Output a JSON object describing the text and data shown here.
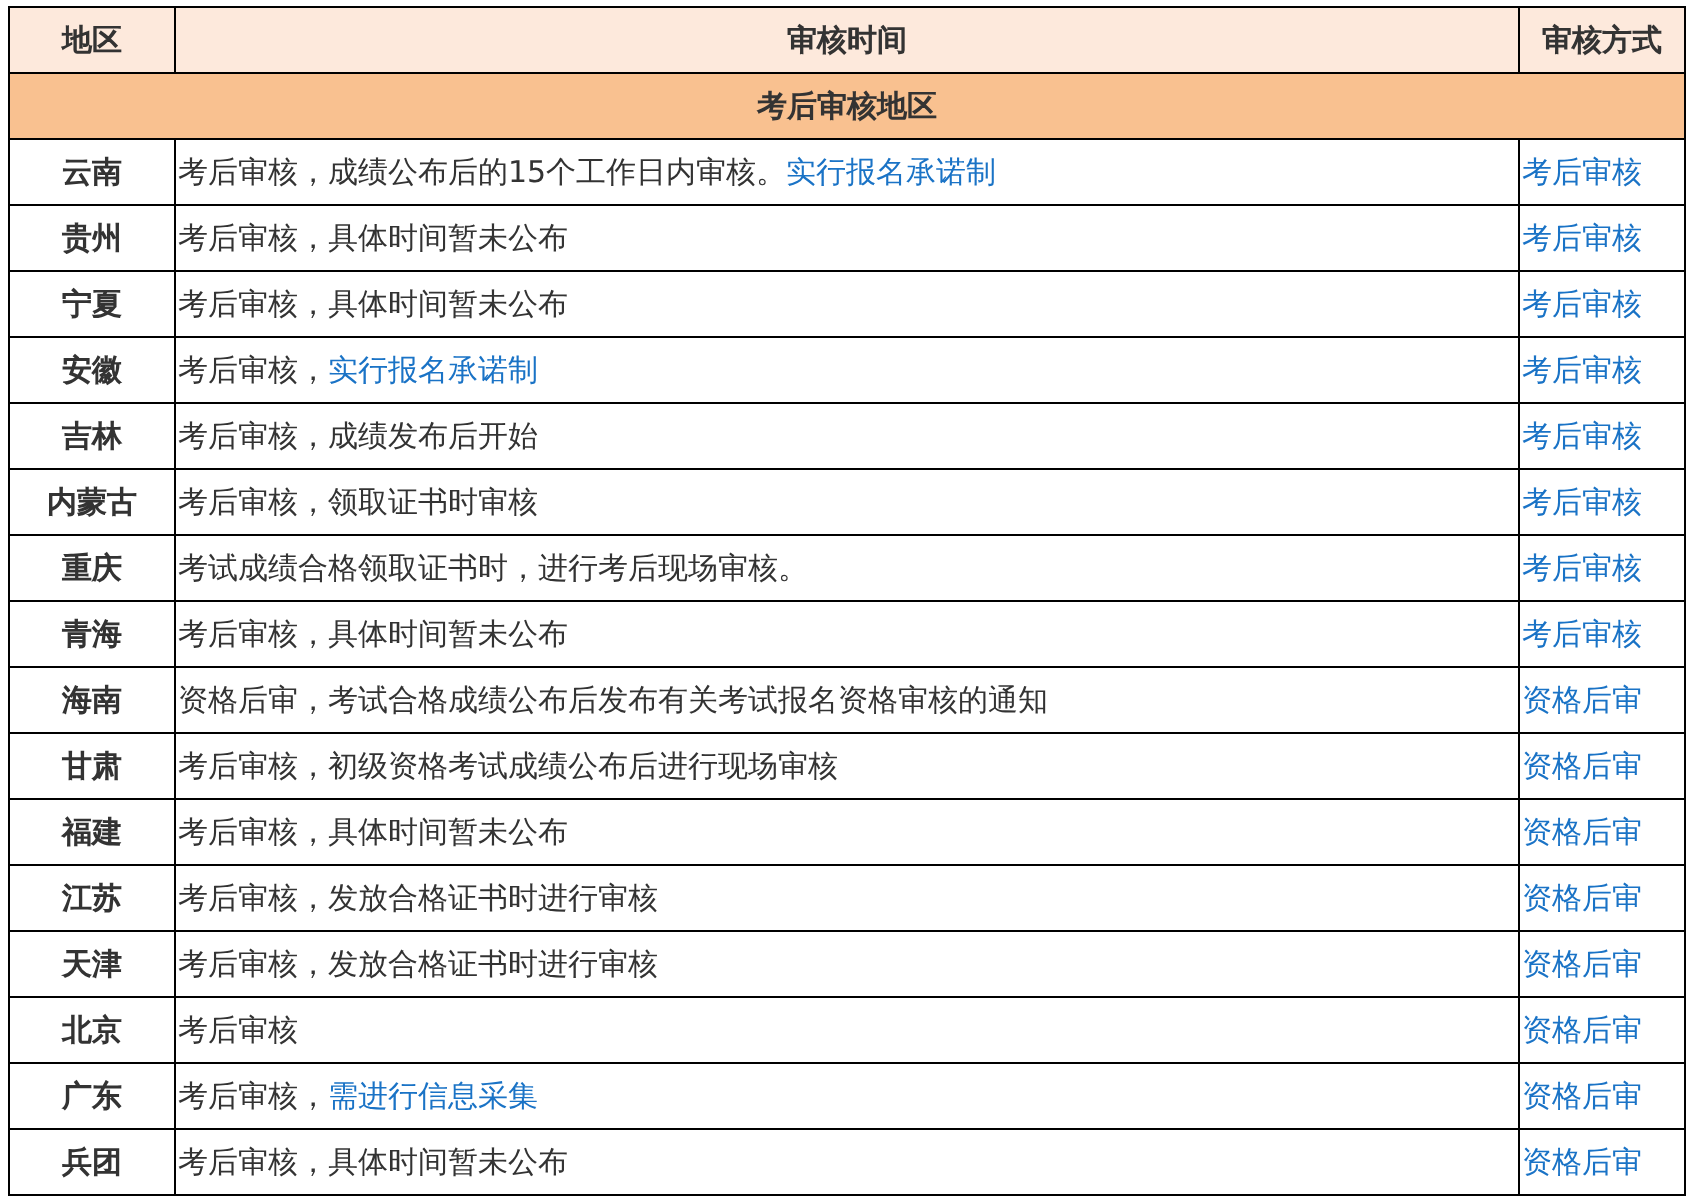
{
  "table": {
    "columns": [
      "地区",
      "审核时间",
      "审核方式"
    ],
    "section": "考后审核地区",
    "rows": [
      {
        "region": "云南",
        "time": [
          {
            "kind": "text",
            "text": "考后审核，成绩公布后的15个工作日内审核。"
          },
          {
            "kind": "link",
            "text": "实行报名承诺制"
          }
        ],
        "method": "考后审核"
      },
      {
        "region": "贵州",
        "time": [
          {
            "kind": "text",
            "text": "考后审核，具体时间暂未公布"
          }
        ],
        "method": "考后审核"
      },
      {
        "region": "宁夏",
        "time": [
          {
            "kind": "text",
            "text": "考后审核，具体时间暂未公布"
          }
        ],
        "method": "考后审核"
      },
      {
        "region": "安徽",
        "time": [
          {
            "kind": "text",
            "text": "考后审核，"
          },
          {
            "kind": "link",
            "text": "实行报名承诺制"
          }
        ],
        "method": "考后审核"
      },
      {
        "region": "吉林",
        "time": [
          {
            "kind": "text",
            "text": "考后审核，成绩发布后开始"
          }
        ],
        "method": "考后审核"
      },
      {
        "region": "内蒙古",
        "time": [
          {
            "kind": "text",
            "text": "考后审核，领取证书时审核"
          }
        ],
        "method": "考后审核"
      },
      {
        "region": "重庆",
        "time": [
          {
            "kind": "text",
            "text": "考试成绩合格领取证书时，进行考后现场审核。"
          }
        ],
        "method": "考后审核"
      },
      {
        "region": "青海",
        "time": [
          {
            "kind": "text",
            "text": "考后审核，具体时间暂未公布"
          }
        ],
        "method": "考后审核"
      },
      {
        "region": "海南",
        "time": [
          {
            "kind": "text",
            "text": "资格后审，考试合格成绩公布后发布有关考试报名资格审核的通知"
          }
        ],
        "method": "资格后审"
      },
      {
        "region": "甘肃",
        "time": [
          {
            "kind": "text",
            "text": "考后审核，初级资格考试成绩公布后进行现场审核"
          }
        ],
        "method": "资格后审"
      },
      {
        "region": "福建",
        "time": [
          {
            "kind": "text",
            "text": "考后审核，具体时间暂未公布"
          }
        ],
        "method": "资格后审"
      },
      {
        "region": "江苏",
        "time": [
          {
            "kind": "text",
            "text": "考后审核，发放合格证书时进行审核"
          }
        ],
        "method": "资格后审"
      },
      {
        "region": "天津",
        "time": [
          {
            "kind": "text",
            "text": "考后审核，发放合格证书时进行审核"
          }
        ],
        "method": "资格后审"
      },
      {
        "region": "北京",
        "time": [
          {
            "kind": "text",
            "text": "考后审核"
          }
        ],
        "method": "资格后审"
      },
      {
        "region": "广东",
        "time": [
          {
            "kind": "text",
            "text": "考后审核，"
          },
          {
            "kind": "link",
            "text": "需进行信息采集"
          }
        ],
        "method": "资格后审"
      },
      {
        "region": "兵团",
        "time": [
          {
            "kind": "text",
            "text": "考后审核，具体时间暂未公布"
          }
        ],
        "method": "资格后审"
      }
    ]
  }
}
